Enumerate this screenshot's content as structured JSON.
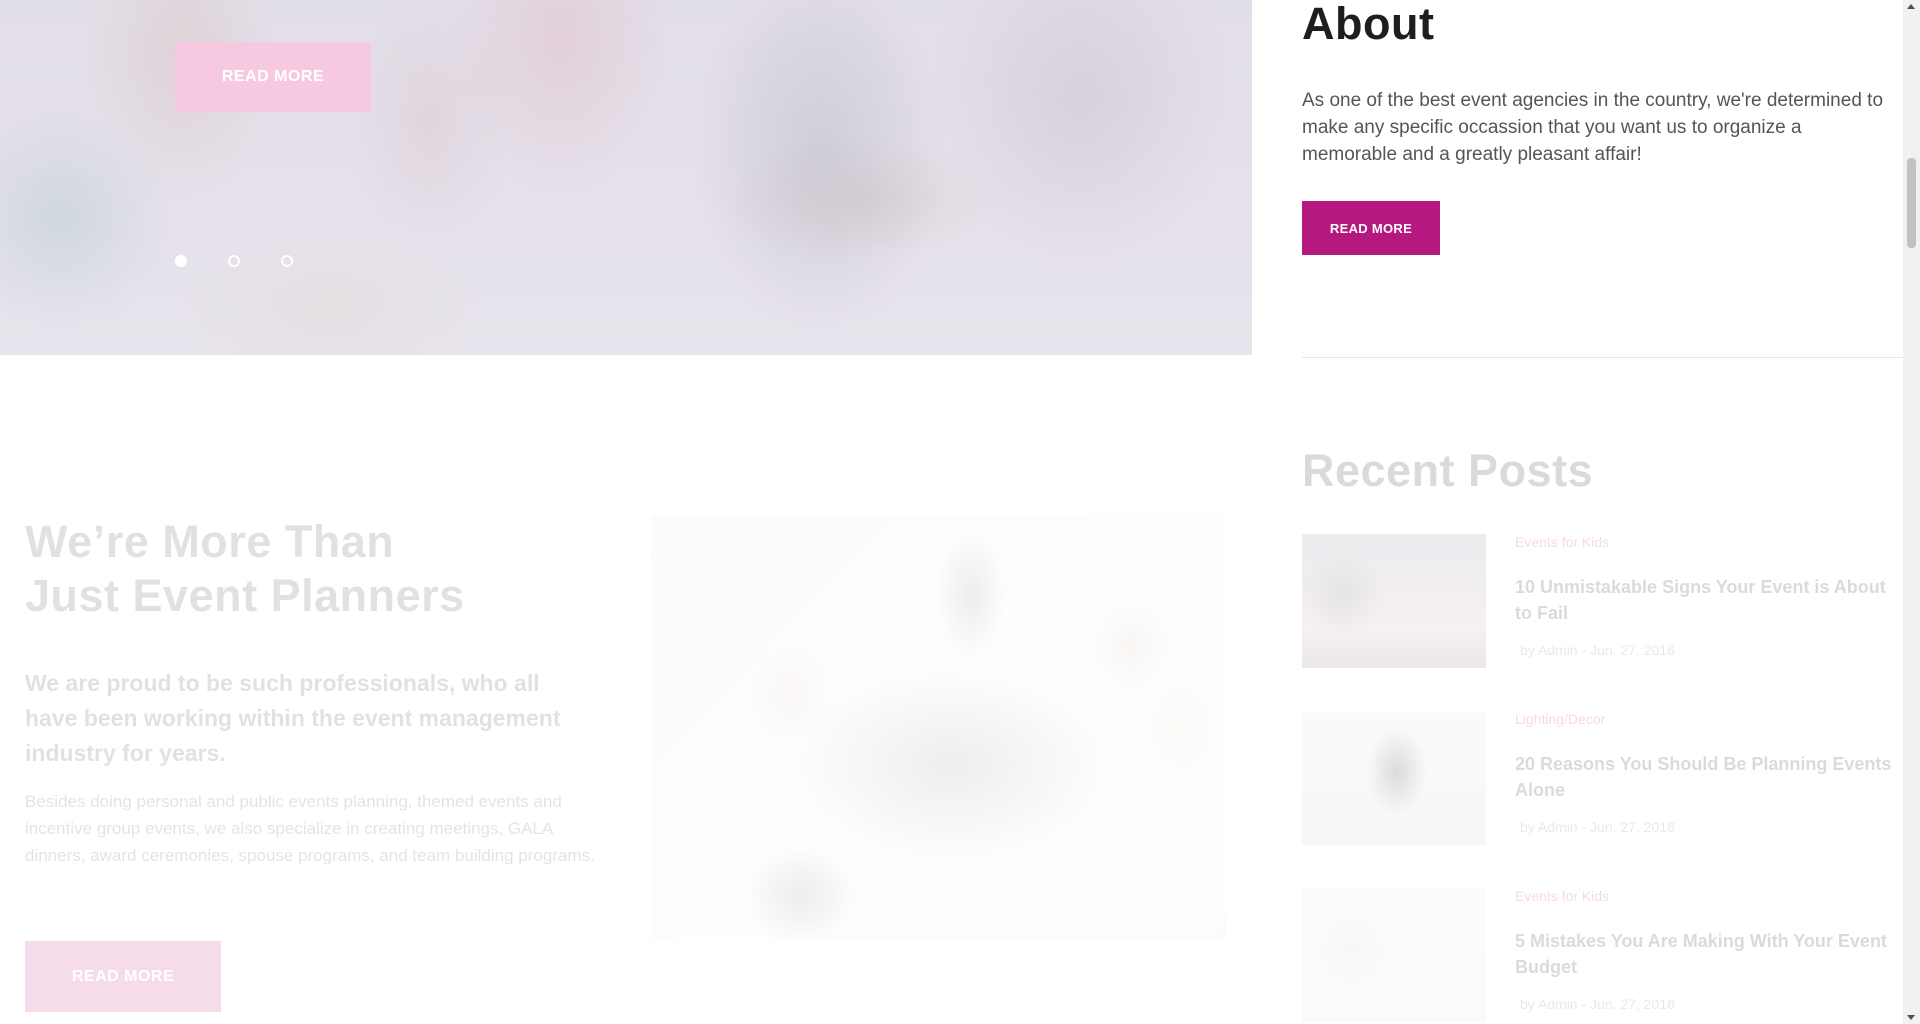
{
  "hero": {
    "read_more_label": "READ MORE",
    "slides_total": 3,
    "active_slide": 1
  },
  "intro": {
    "heading_line1": "We’re More Than",
    "heading_line2": "Just Event Planners",
    "lead": "We are proud to be such professionals, who all have been working within the event management industry for years.",
    "body": "Besides doing personal and public events planning, themed events and incentive group events, we also specialize in creating meetings, GALA dinners, award ceremonies, spouse programs, and team building programs.",
    "read_more_label": "READ MORE"
  },
  "sidebar": {
    "about": {
      "title": "About",
      "text": "As one of the best event agencies in the country, we're determined to make any specific occassion that you want us to organize a memorable and a greatly pleasant affair!",
      "read_more_label": "READ MORE"
    },
    "recent_posts": {
      "title": "Recent Posts",
      "posts": [
        {
          "category": "Events for Kids",
          "title": "10 Unmistakable Signs Your Event is About to Fail",
          "meta": "by Admin - Jun. 27, 2016"
        },
        {
          "category": "Lighting/Decor",
          "title": "20 Reasons You Should Be Planning Events Alone",
          "meta": "by Admin - Jun. 27, 2016"
        },
        {
          "category": "Events for Kids",
          "title": "5 Mistakes You Are Making With Your Event Budget",
          "meta": "by Admin - Jun. 27, 2016"
        }
      ]
    }
  },
  "colors": {
    "accent": "#b5187e",
    "accent_faded": "#f6c9e0"
  }
}
